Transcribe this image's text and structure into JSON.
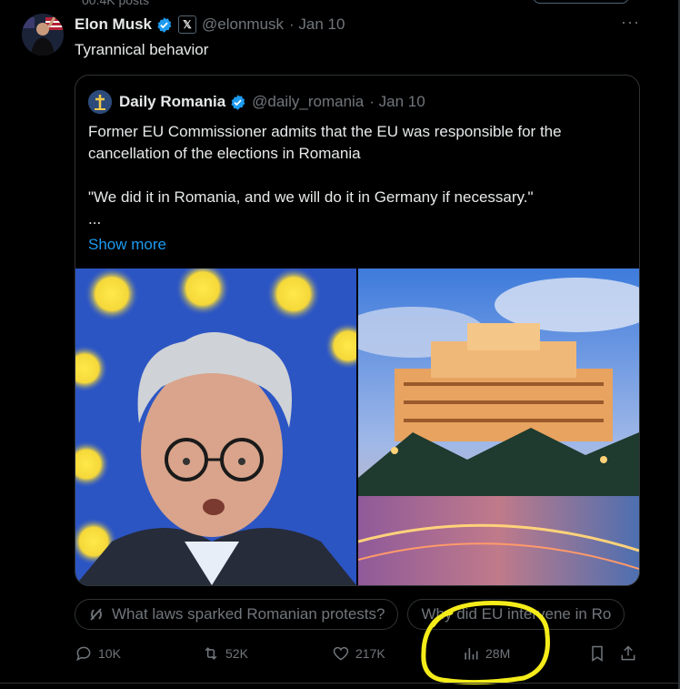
{
  "top_partial": "00.4K posts",
  "author": {
    "name": "Elon Musk",
    "x_badge": "𝕏",
    "handle": "@elonmusk",
    "date": "· Jan 10"
  },
  "more_label": "···",
  "tweet_text": "Tyrannical behavior",
  "quote": {
    "name": "Daily Romania",
    "handle": "@daily_romania",
    "date": "· Jan 10",
    "line1": "Former EU Commissioner admits that the EU was responsible for the cancellation of the elections in Romania",
    "line2": "\"We did it in Romania, and we will do it in Germany if necessary.\"",
    "ellipsis": "...",
    "show_more": "Show more"
  },
  "chips": [
    {
      "label": "What laws sparked Romanian protests?"
    },
    {
      "label": "Why did EU intervene in Ro"
    }
  ],
  "actions": {
    "replies": "10K",
    "reposts": "52K",
    "likes": "217K",
    "views": "28M"
  },
  "colors": {
    "accent": "#1d9bf0",
    "muted": "#71767b",
    "highlight": "#f5ec1a"
  }
}
